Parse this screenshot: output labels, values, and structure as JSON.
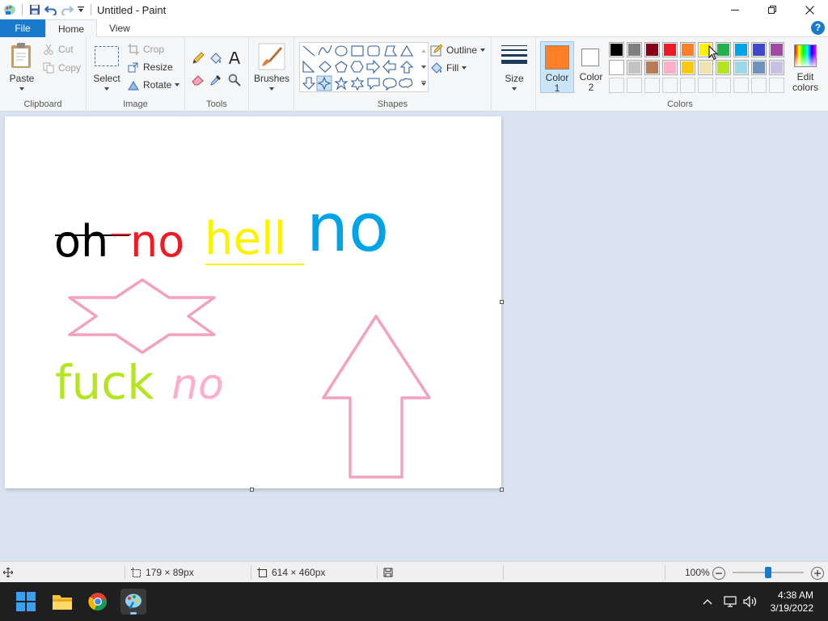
{
  "window": {
    "title": "Untitled - Paint"
  },
  "tabs": {
    "file": "File",
    "home": "Home",
    "view": "View"
  },
  "help": "?",
  "clipboard": {
    "paste": "Paste",
    "cut": "Cut",
    "copy": "Copy",
    "label": "Clipboard"
  },
  "image": {
    "select": "Select",
    "crop": "Crop",
    "resize": "Resize",
    "rotate": "Rotate",
    "label": "Image"
  },
  "tools": {
    "label": "Tools"
  },
  "brushes": {
    "label": "Brushes"
  },
  "shapes": {
    "outline": "Outline",
    "fill": "Fill",
    "label": "Shapes"
  },
  "size": {
    "label": "Size"
  },
  "colors": {
    "color1": "Color 1",
    "color2": "Color 2",
    "color1_value": "#ff7f27",
    "color2_value": "#ffffff",
    "edit": "Edit colors",
    "label": "Colors",
    "row1": [
      "#000000",
      "#7f7f7f",
      "#880015",
      "#ed1c24",
      "#ff7f27",
      "#fff200",
      "#22b14c",
      "#00a2e8",
      "#3f48cc",
      "#a349a4"
    ],
    "row2": [
      "#ffffff",
      "#c3c3c3",
      "#b97a57",
      "#ffaec9",
      "#ffc90e",
      "#efe4b0",
      "#b5e61d",
      "#99d9ea",
      "#7092be",
      "#c8bfe7"
    ]
  },
  "canvas_text": {
    "oh": "oh",
    "no_red": "no",
    "hell": "hell",
    "no_blue": "no",
    "fuck": "fuck",
    "no_pink": "no"
  },
  "status": {
    "selection": "179 × 89px",
    "canvas_size": "614 × 460px",
    "zoom": "100%"
  },
  "taskbar": {
    "time": "4:38 AM",
    "date": "3/19/2022"
  }
}
